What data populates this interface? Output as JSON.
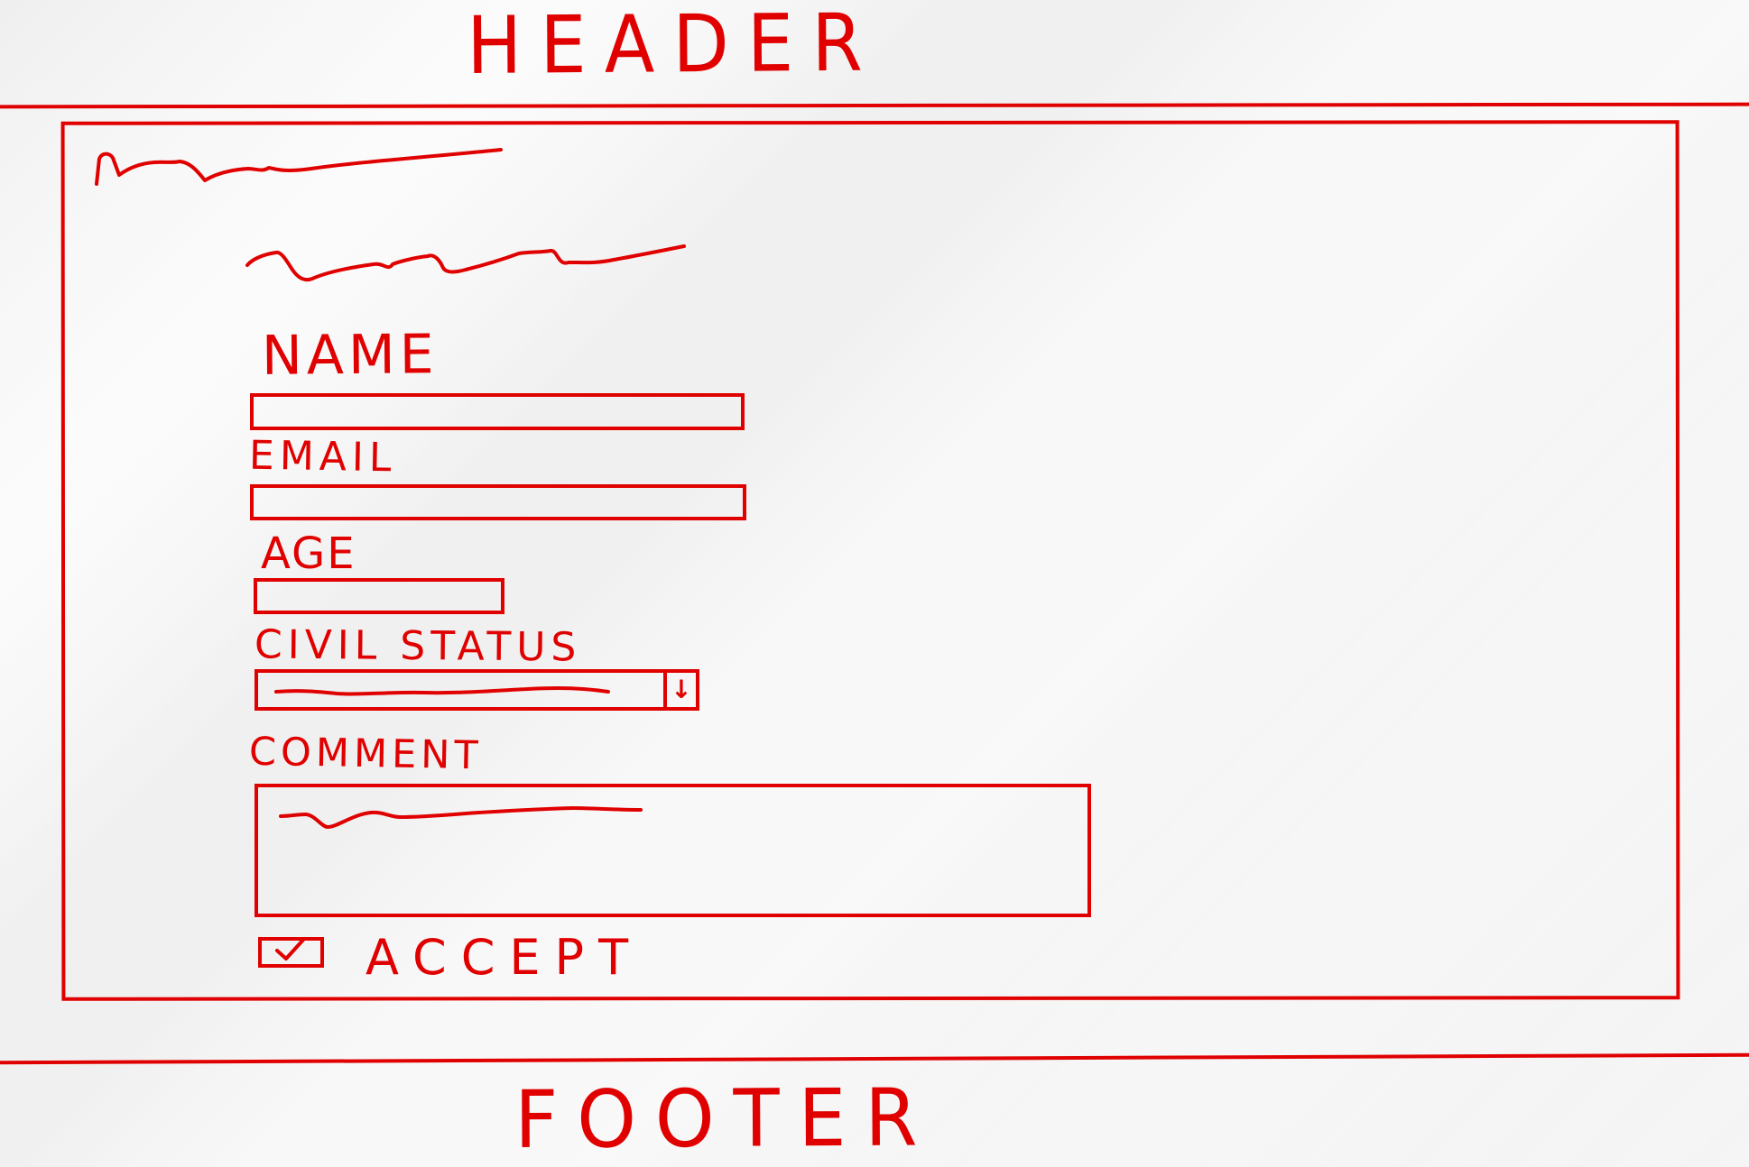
{
  "header": {
    "title": "HEADER"
  },
  "form": {
    "name_label": "NAME",
    "email_label": "EMAIL",
    "age_label": "AGE",
    "civil_status_label": "CIVIL STATUS",
    "comment_label": "COMMENT",
    "accept_label": "ACCEPT",
    "accept_checked": true
  },
  "footer": {
    "title": "FOOTER"
  },
  "colors": {
    "accent": "#e00000",
    "background": "#f3f3f3"
  },
  "icons": {
    "dropdown": "down-arrow-icon",
    "checkbox": "check-icon"
  }
}
